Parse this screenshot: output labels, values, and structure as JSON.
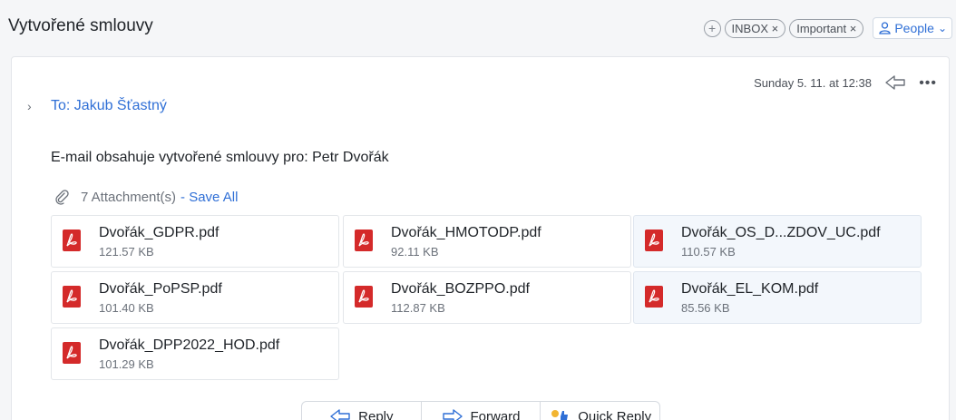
{
  "header": {
    "subject": "Vytvořené smlouvy",
    "tags": [
      {
        "label": "INBOX ×"
      },
      {
        "label": "Important ×"
      }
    ],
    "people_label": "People",
    "people_chevron": "⌄"
  },
  "message": {
    "date": "Sunday 5. 11. at 12:38",
    "to": "To: Jakub Šťastný",
    "body": "E-mail obsahuje vytvořené smlouvy pro: Petr Dvořák",
    "attachments_count": "7 Attachment(s)",
    "save_all": "- Save All"
  },
  "attachments": [
    {
      "name": "Dvořák_GDPR.pdf",
      "size": "121.57 KB"
    },
    {
      "name": "Dvořák_HMOTODP.pdf",
      "size": "92.11 KB"
    },
    {
      "name": "Dvořák_OS_D...ZDOV_UC.pdf",
      "size": "110.57 KB"
    },
    {
      "name": "Dvořák_PoPSP.pdf",
      "size": "101.40 KB"
    },
    {
      "name": "Dvořák_BOZPPO.pdf",
      "size": "112.87 KB"
    },
    {
      "name": "Dvořák_EL_KOM.pdf",
      "size": "85.56 KB"
    },
    {
      "name": "Dvořák_DPP2022_HOD.pdf",
      "size": "101.29 KB"
    }
  ],
  "actions": {
    "reply": "Reply",
    "forward": "Forward",
    "quick_reply": "Quick Reply"
  },
  "colors": {
    "accent": "#2f6fd6",
    "pdf_red": "#d42a2a"
  }
}
